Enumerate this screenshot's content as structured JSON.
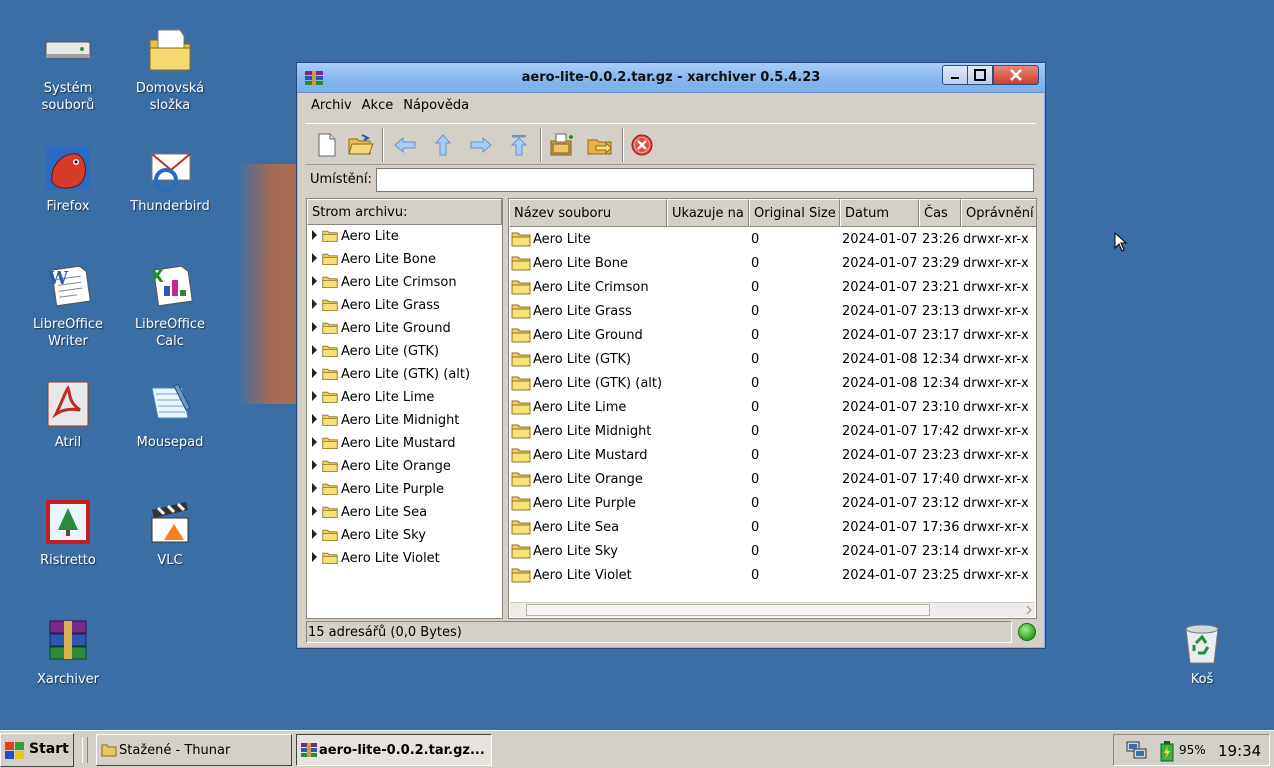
{
  "desktop": {
    "icons": [
      {
        "label": "Systém souborů",
        "icon": "drive-icon"
      },
      {
        "label": "Domovská složka",
        "icon": "home-folder-icon"
      },
      {
        "label": "Firefox",
        "icon": "firefox-icon"
      },
      {
        "label": "Thunderbird",
        "icon": "thunderbird-icon"
      },
      {
        "label": "LibreOffice Writer",
        "icon": "writer-icon"
      },
      {
        "label": "LibreOffice Calc",
        "icon": "calc-icon"
      },
      {
        "label": "Atril",
        "icon": "pdf-icon"
      },
      {
        "label": "Mousepad",
        "icon": "notepad-icon"
      },
      {
        "label": "Ristretto",
        "icon": "image-viewer-icon"
      },
      {
        "label": "VLC",
        "icon": "vlc-icon"
      },
      {
        "label": "Xarchiver",
        "icon": "archive-icon"
      },
      {
        "label": "Koš",
        "icon": "trash-icon"
      }
    ]
  },
  "window": {
    "title": "aero-lite-0.0.2.tar.gz - xarchiver 0.5.4.23",
    "menu": [
      "Archiv",
      "Akce",
      "Nápověda"
    ],
    "location_label": "Umístění:",
    "location_value": "",
    "tree_header": "Strom archivu:",
    "columns": [
      "Název souboru",
      "Ukazuje na",
      "Original Size",
      "Datum",
      "Čas",
      "Oprávnění"
    ],
    "items": [
      {
        "name": "Aero Lite",
        "link": "",
        "size": "0",
        "date": "2024-01-07",
        "time": "23:26",
        "perm": "drwxr-xr-x"
      },
      {
        "name": "Aero Lite Bone",
        "link": "",
        "size": "0",
        "date": "2024-01-07",
        "time": "23:29",
        "perm": "drwxr-xr-x"
      },
      {
        "name": "Aero Lite Crimson",
        "link": "",
        "size": "0",
        "date": "2024-01-07",
        "time": "23:21",
        "perm": "drwxr-xr-x"
      },
      {
        "name": "Aero Lite Grass",
        "link": "",
        "size": "0",
        "date": "2024-01-07",
        "time": "23:13",
        "perm": "drwxr-xr-x"
      },
      {
        "name": "Aero Lite Ground",
        "link": "",
        "size": "0",
        "date": "2024-01-07",
        "time": "23:17",
        "perm": "drwxr-xr-x"
      },
      {
        "name": "Aero Lite (GTK)",
        "link": "",
        "size": "0",
        "date": "2024-01-08",
        "time": "12:34",
        "perm": "drwxr-xr-x"
      },
      {
        "name": "Aero Lite (GTK) (alt)",
        "link": "",
        "size": "0",
        "date": "2024-01-08",
        "time": "12:34",
        "perm": "drwxr-xr-x"
      },
      {
        "name": "Aero Lite Lime",
        "link": "",
        "size": "0",
        "date": "2024-01-07",
        "time": "23:10",
        "perm": "drwxr-xr-x"
      },
      {
        "name": "Aero Lite Midnight",
        "link": "",
        "size": "0",
        "date": "2024-01-07",
        "time": "17:42",
        "perm": "drwxr-xr-x"
      },
      {
        "name": "Aero Lite Mustard",
        "link": "",
        "size": "0",
        "date": "2024-01-07",
        "time": "23:23",
        "perm": "drwxr-xr-x"
      },
      {
        "name": "Aero Lite Orange",
        "link": "",
        "size": "0",
        "date": "2024-01-07",
        "time": "17:40",
        "perm": "drwxr-xr-x"
      },
      {
        "name": "Aero Lite Purple",
        "link": "",
        "size": "0",
        "date": "2024-01-07",
        "time": "23:12",
        "perm": "drwxr-xr-x"
      },
      {
        "name": "Aero Lite Sea",
        "link": "",
        "size": "0",
        "date": "2024-01-07",
        "time": "17:36",
        "perm": "drwxr-xr-x"
      },
      {
        "name": "Aero Lite Sky",
        "link": "",
        "size": "0",
        "date": "2024-01-07",
        "time": "23:14",
        "perm": "drwxr-xr-x"
      },
      {
        "name": "Aero Lite Violet",
        "link": "",
        "size": "0",
        "date": "2024-01-07",
        "time": "23:25",
        "perm": "drwxr-xr-x"
      }
    ],
    "status": "15 adresářů  (0,0 Bytes)"
  },
  "taskbar": {
    "start": "Start",
    "tasks": [
      {
        "label": "Stažené - Thunar",
        "active": false
      },
      {
        "label": "aero-lite-0.0.2.tar.gz...",
        "active": true
      }
    ],
    "battery": "95%",
    "clock": "19:34"
  },
  "colors": {
    "desktop": "#3a6ea5",
    "titlebar": "#8ab8ee",
    "window": "#d4d0c8"
  }
}
